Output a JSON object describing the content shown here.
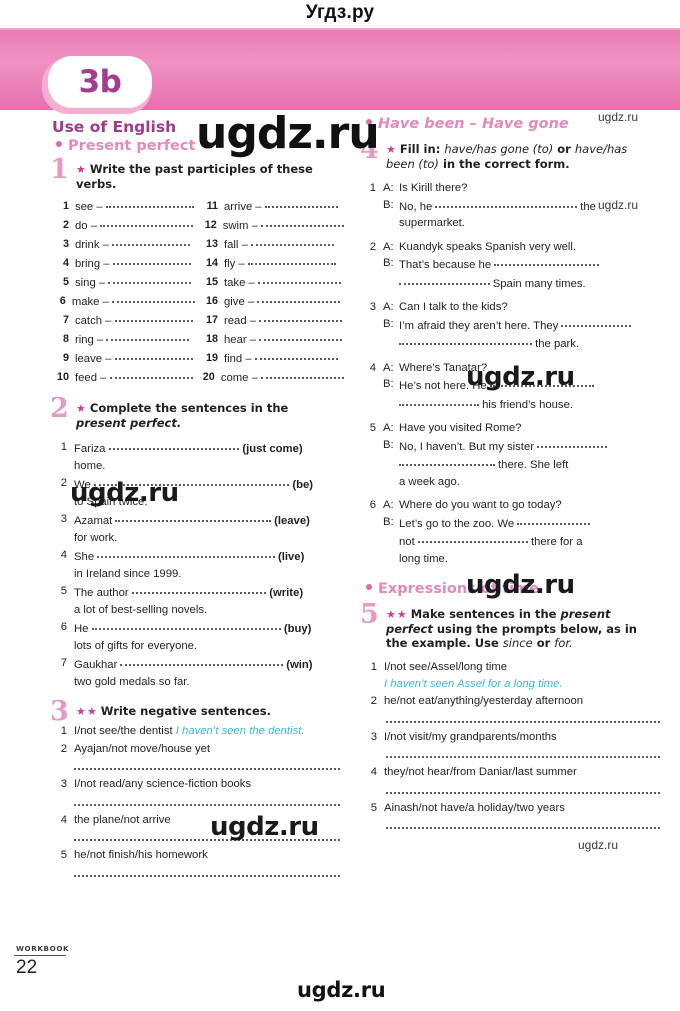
{
  "site": {
    "title_top": "Угдз.ру",
    "watermark_large": "ugdz.ru",
    "watermark_small": "ugdz.ru",
    "watermark_bottom": "ugdz.ru"
  },
  "banner": {
    "unit_tab": "3b",
    "tab_bg": "#ffffff",
    "tab_text_color": "#a43d8e",
    "banner_color": "#e87bb4"
  },
  "left_column": {
    "section_title": "Use of English",
    "subsection": "Present perfect",
    "exercise1": {
      "number": "1",
      "stars": "★",
      "instruction_bold": "Write the past participles of these verbs.",
      "items_left": [
        {
          "n": "1",
          "w": "see – "
        },
        {
          "n": "2",
          "w": "do – "
        },
        {
          "n": "3",
          "w": "drink – "
        },
        {
          "n": "4",
          "w": "bring – "
        },
        {
          "n": "5",
          "w": "sing – "
        },
        {
          "n": "6",
          "w": "make – "
        },
        {
          "n": "7",
          "w": "catch – "
        },
        {
          "n": "8",
          "w": "ring – "
        },
        {
          "n": "9",
          "w": "leave – "
        },
        {
          "n": "10",
          "w": "feed – "
        }
      ],
      "items_right": [
        {
          "n": "11",
          "w": "arrive – "
        },
        {
          "n": "12",
          "w": "swim – "
        },
        {
          "n": "13",
          "w": "fall – "
        },
        {
          "n": "14",
          "w": "fly – "
        },
        {
          "n": "15",
          "w": "take – "
        },
        {
          "n": "16",
          "w": "give – "
        },
        {
          "n": "17",
          "w": "read – "
        },
        {
          "n": "18",
          "w": "hear – "
        },
        {
          "n": "19",
          "w": "find – "
        },
        {
          "n": "20",
          "w": "come – "
        }
      ]
    },
    "exercise2": {
      "number": "2",
      "stars": "★",
      "instruction_bold": "Complete the sentences in the",
      "instruction_italic": "present perfect.",
      "items": [
        {
          "n": "1",
          "pre": "Fariza ",
          "cue": "(just come)",
          "post": "home."
        },
        {
          "n": "2",
          "pre": "We ",
          "cue": "(be)",
          "post": "to Spain twice."
        },
        {
          "n": "3",
          "pre": "Azamat ",
          "cue": "(leave)",
          "post": "for work."
        },
        {
          "n": "4",
          "pre": "She ",
          "cue": "(live)",
          "post": "in Ireland since 1999."
        },
        {
          "n": "5",
          "pre": "The author ",
          "cue": "(write)",
          "post": "a lot of  best-selling novels."
        },
        {
          "n": "6",
          "pre": "He ",
          "cue": "(buy)",
          "post": "lots of gifts for everyone."
        },
        {
          "n": "7",
          "pre": "Gaukhar ",
          "cue": "(win)",
          "post": "two gold medals so far."
        }
      ]
    },
    "exercise3": {
      "number": "3",
      "stars": "★★",
      "instruction_bold": "Write negative sentences.",
      "items": [
        {
          "n": "1",
          "prompt": "I/not see/the dentist",
          "answer": "I haven’t seen the dentist.",
          "rule": false
        },
        {
          "n": "2",
          "prompt": "Ayajan/not move/house yet",
          "answer": "",
          "rule": true
        },
        {
          "n": "3",
          "prompt": "I/not read/any science-fiction books",
          "answer": "",
          "rule": true
        },
        {
          "n": "4",
          "prompt": "the plane/not arrive",
          "answer": "",
          "rule": true
        },
        {
          "n": "5",
          "prompt": "he/not finish/his homework",
          "answer": "",
          "rule": true
        }
      ]
    }
  },
  "right_column": {
    "subsection1": "Have been – Have gone",
    "exercise4": {
      "number": "4",
      "stars": "★",
      "instruction_lead": "Fill in:",
      "instruction_i1": "have/has gone (to)",
      "instruction_or": "or",
      "instruction_i2": "have/has",
      "instruction_i3": "been (to)",
      "instruction_tail": "in the correct form.",
      "items": [
        {
          "n": "1",
          "a": "Is Kirill there?",
          "b_pre": "No, he ",
          "b_post": " the",
          "b_cont": "supermarket."
        },
        {
          "n": "2",
          "a": "Kuandyk speaks Spanish very well.",
          "b_pre": "That’s because he ",
          "b_post": "",
          "b_cont": " Spain many times."
        },
        {
          "n": "3",
          "a": "Can I talk to the kids?",
          "b_pre": "I’m afraid they aren’t here. They  ",
          "b_post": "",
          "b_cont": " the park."
        },
        {
          "n": "4",
          "a": "Where’s Tanatar?",
          "b_pre": "He’s not here. He ",
          "b_post": "",
          "b_cont": " his friend’s house."
        },
        {
          "n": "5",
          "a": "Have you visited Rome?",
          "b_pre": "No, I haven’t. But my sister ",
          "b_post": "",
          "b_cont": " there.  She left",
          "b_cont2": "a week ago."
        },
        {
          "n": "6",
          "a": "Where do you want to go today?",
          "b_pre": "Let’s go to the zoo. We ",
          "b_post": "",
          "b_cont": "not ",
          "b_cont_tail": " there for a",
          "b_cont2": "long time."
        }
      ]
    },
    "subsection2": "Expressions of time",
    "exercise5": {
      "number": "5",
      "stars": "★★",
      "instruction_b1": "Make sentences in the",
      "instruction_i1": "present",
      "instruction_i2": "perfect",
      "instruction_b2": "using the prompts below, as in",
      "instruction_b3": "the example. Use",
      "instruction_i3": "since",
      "instruction_or": "or",
      "instruction_i4": "for.",
      "items": [
        {
          "n": "1",
          "prompt": "I/not see/Assel/long time",
          "answer": "I haven’t seen Assel for a long time.",
          "rule": false
        },
        {
          "n": "2",
          "prompt": "he/not eat/anything/yesterday afternoon",
          "answer": "",
          "rule": true
        },
        {
          "n": "3",
          "prompt": "I/not visit/my grandparents/months",
          "answer": "",
          "rule": true
        },
        {
          "n": "4",
          "prompt": "they/not hear/from Daniar/last summer",
          "answer": "",
          "rule": true
        },
        {
          "n": "5",
          "prompt": "Ainash/not have/a holiday/two years",
          "answer": "",
          "rule": true
        }
      ]
    }
  },
  "footer": {
    "label": "WORKBOOK",
    "page": "22"
  }
}
